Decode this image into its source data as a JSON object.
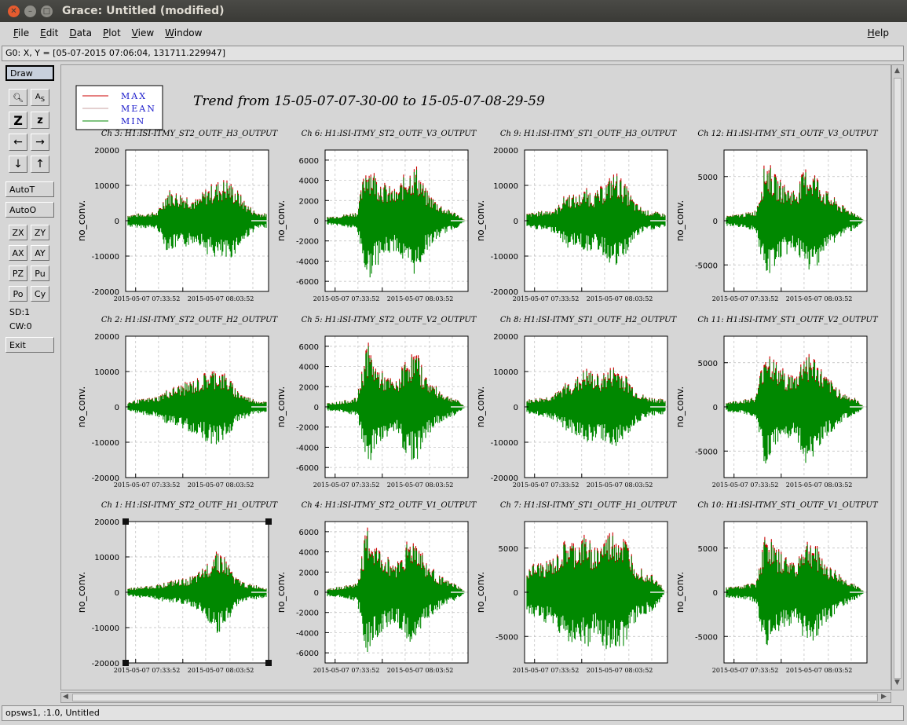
{
  "window": {
    "title": "Grace: Untitled (modified)"
  },
  "menu": {
    "items": [
      "File",
      "Edit",
      "Data",
      "Plot",
      "View",
      "Window"
    ],
    "help": "Help"
  },
  "locator": "G0: X, Y = [05-07-2015 07:06:04, 131711.229947]",
  "toolbar": {
    "draw": "Draw",
    "autot": "AutoT",
    "autoo": "AutoO",
    "zx": "ZX",
    "zy": "ZY",
    "ax": "AX",
    "ay": "AY",
    "pz": "PZ",
    "pu": "Pu",
    "po": "Po",
    "cy": "Cy",
    "sd": "SD:1",
    "cw": "CW:0",
    "exit": "Exit"
  },
  "status": "opsws1, :1.0, Untitled",
  "figure": {
    "title": "Trend from 15-05-07-07-30-00 to 15-05-07-08-29-59",
    "legend": [
      {
        "label": "MAX",
        "color": "#cc0000"
      },
      {
        "label": "MEAN",
        "color": "#c8a0a0"
      },
      {
        "label": "MIN",
        "color": "#008800"
      }
    ],
    "ylabel": "no_conv.",
    "xticks": [
      "2015-05-07 07:33:52",
      "2015-05-07 08:03:52"
    ]
  },
  "chart_data": [
    {
      "type": "line",
      "title": "Ch 3: H1:ISI-ITMY_ST2_OUTF_H3_OUTPUT",
      "ylabel": "no_conv.",
      "ylim": [
        -20000,
        20000
      ],
      "yticks": [
        20000,
        10000,
        0,
        -10000,
        -20000
      ],
      "xticks": [
        "2015-05-07 07:33:52",
        "2015-05-07 08:03:52"
      ],
      "series": [
        {
          "name": "MAX"
        },
        {
          "name": "MEAN"
        },
        {
          "name": "MIN"
        }
      ],
      "envelope": [
        1800,
        2000,
        2200,
        2500,
        9000,
        8000,
        7500,
        6000,
        9500,
        11000,
        12000,
        9000,
        5000,
        2500,
        2000
      ],
      "pos": [
        0,
        0
      ]
    },
    {
      "type": "line",
      "title": "Ch 6: H1:ISI-ITMY_ST2_OUTF_V3_OUTPUT",
      "ylabel": "no_conv.",
      "ylim": [
        -7000,
        7000
      ],
      "yticks": [
        6000,
        4000,
        2000,
        0,
        -2000,
        -4000,
        -6000
      ],
      "xticks": [
        "2015-05-07 07:33:52",
        "2015-05-07 08:03:52"
      ],
      "series": [
        {
          "name": "MAX"
        },
        {
          "name": "MEAN"
        },
        {
          "name": "MIN"
        }
      ],
      "envelope": [
        400,
        500,
        700,
        900,
        6200,
        4500,
        3500,
        3000,
        5000,
        5500,
        3000,
        2000,
        1200,
        800,
        0
      ],
      "pos": [
        0,
        1
      ]
    },
    {
      "type": "line",
      "title": "Ch 9: H1:ISI-ITMY_ST1_OUTF_H3_OUTPUT",
      "ylabel": "no_conv.",
      "ylim": [
        -20000,
        20000
      ],
      "yticks": [
        20000,
        10000,
        0,
        -10000,
        -20000
      ],
      "xticks": [
        "2015-05-07 07:33:52",
        "2015-05-07 08:03:52"
      ],
      "series": [
        {
          "name": "MAX"
        },
        {
          "name": "MEAN"
        },
        {
          "name": "MIN"
        }
      ],
      "envelope": [
        2000,
        2500,
        3000,
        3500,
        8000,
        7000,
        9000,
        8000,
        11000,
        14000,
        10000,
        5000,
        3000,
        2500,
        2000
      ],
      "pos": [
        0,
        2
      ]
    },
    {
      "type": "line",
      "title": "Ch 12: H1:ISI-ITMY_ST1_OUTF_V3_OUTPUT",
      "ylabel": "no_conv.",
      "ylim": [
        -8000,
        8000
      ],
      "yticks": [
        5000,
        0,
        -5000
      ],
      "xticks": [
        "2015-05-07 07:33:52",
        "2015-05-07 08:03:52"
      ],
      "series": [
        {
          "name": "MAX"
        },
        {
          "name": "MEAN"
        },
        {
          "name": "MIN"
        }
      ],
      "envelope": [
        600,
        700,
        900,
        1200,
        7200,
        5000,
        4000,
        3500,
        6000,
        5500,
        3500,
        2500,
        1500,
        1000,
        0
      ],
      "pos": [
        0,
        3
      ]
    },
    {
      "type": "line",
      "title": "Ch 2: H1:ISI-ITMY_ST2_OUTF_H2_OUTPUT",
      "ylabel": "no_conv.",
      "ylim": [
        -20000,
        20000
      ],
      "yticks": [
        20000,
        10000,
        0,
        -10000,
        -20000
      ],
      "xticks": [
        "2015-05-07 07:33:52",
        "2015-05-07 08:03:52"
      ],
      "series": [
        {
          "name": "MAX"
        },
        {
          "name": "MEAN"
        },
        {
          "name": "MIN"
        }
      ],
      "envelope": [
        1500,
        2000,
        2500,
        3000,
        5000,
        6000,
        7000,
        8000,
        10000,
        11000,
        9000,
        5000,
        3000,
        2000,
        1500
      ],
      "pos": [
        1,
        0
      ]
    },
    {
      "type": "line",
      "title": "Ch 5: H1:ISI-ITMY_ST2_OUTF_V2_OUTPUT",
      "ylabel": "no_conv.",
      "ylim": [
        -7000,
        7000
      ],
      "yticks": [
        6000,
        4000,
        2000,
        0,
        -2000,
        -4000,
        -6000
      ],
      "xticks": [
        "2015-05-07 07:33:52",
        "2015-05-07 08:03:52"
      ],
      "series": [
        {
          "name": "MAX"
        },
        {
          "name": "MEAN"
        },
        {
          "name": "MIN"
        }
      ],
      "envelope": [
        400,
        500,
        700,
        900,
        6500,
        4000,
        3000,
        2500,
        5000,
        5500,
        3000,
        2000,
        1200,
        800,
        0
      ],
      "pos": [
        1,
        1
      ]
    },
    {
      "type": "line",
      "title": "Ch 8: H1:ISI-ITMY_ST1_OUTF_H2_OUTPUT",
      "ylabel": "no_conv.",
      "ylim": [
        -20000,
        20000
      ],
      "yticks": [
        20000,
        10000,
        0,
        -10000,
        -20000
      ],
      "xticks": [
        "2015-05-07 07:33:52",
        "2015-05-07 08:03:52"
      ],
      "series": [
        {
          "name": "MAX"
        },
        {
          "name": "MEAN"
        },
        {
          "name": "MIN"
        }
      ],
      "envelope": [
        2000,
        2500,
        3000,
        4000,
        7000,
        8000,
        11000,
        9000,
        10000,
        12000,
        9000,
        5000,
        3000,
        2500,
        2000
      ],
      "pos": [
        1,
        2
      ]
    },
    {
      "type": "line",
      "title": "Ch 11: H1:ISI-ITMY_ST1_OUTF_V2_OUTPUT",
      "ylabel": "no_conv.",
      "ylim": [
        -8000,
        8000
      ],
      "yticks": [
        5000,
        0,
        -5000
      ],
      "xticks": [
        "2015-05-07 07:33:52",
        "2015-05-07 08:03:52"
      ],
      "series": [
        {
          "name": "MAX"
        },
        {
          "name": "MEAN"
        },
        {
          "name": "MIN"
        }
      ],
      "envelope": [
        600,
        700,
        900,
        1200,
        7300,
        5000,
        4000,
        3500,
        6500,
        5500,
        3500,
        2500,
        1500,
        1000,
        0
      ],
      "pos": [
        1,
        3
      ]
    },
    {
      "type": "line",
      "title": "Ch 1: H1:ISI-ITMY_ST2_OUTF_H1_OUTPUT",
      "ylabel": "no_conv.",
      "ylim": [
        -20000,
        20000
      ],
      "yticks": [
        20000,
        10000,
        0,
        -10000,
        -20000
      ],
      "xticks": [
        "2015-05-07 07:33:52",
        "2015-05-07 08:03:52"
      ],
      "series": [
        {
          "name": "MAX"
        },
        {
          "name": "MEAN"
        },
        {
          "name": "MIN"
        }
      ],
      "envelope": [
        1200,
        1500,
        1800,
        2200,
        3000,
        3500,
        4000,
        5000,
        8000,
        13000,
        9000,
        4000,
        2500,
        2000,
        1500
      ],
      "pos": [
        2,
        0
      ],
      "selected": true
    },
    {
      "type": "line",
      "title": "Ch 4: H1:ISI-ITMY_ST2_OUTF_V1_OUTPUT",
      "ylabel": "no_conv.",
      "ylim": [
        -7000,
        7000
      ],
      "yticks": [
        6000,
        4000,
        2000,
        0,
        -2000,
        -4000,
        -6000
      ],
      "xticks": [
        "2015-05-07 07:33:52",
        "2015-05-07 08:03:52"
      ],
      "series": [
        {
          "name": "MAX"
        },
        {
          "name": "MEAN"
        },
        {
          "name": "MIN"
        }
      ],
      "envelope": [
        400,
        500,
        700,
        900,
        6500,
        4500,
        3500,
        3000,
        5000,
        5500,
        3000,
        2000,
        1200,
        800,
        0
      ],
      "pos": [
        2,
        1
      ]
    },
    {
      "type": "line",
      "title": "Ch 7: H1:ISI-ITMY_ST1_OUTF_H1_OUTPUT",
      "ylabel": "no_conv.",
      "ylim": [
        -8000,
        8000
      ],
      "yticks": [
        5000,
        0,
        -5000
      ],
      "xticks": [
        "2015-05-07 07:33:52",
        "2015-05-07 08:03:52"
      ],
      "series": [
        {
          "name": "MAX"
        },
        {
          "name": "MEAN"
        },
        {
          "name": "MIN"
        }
      ],
      "envelope": [
        3000,
        3200,
        3500,
        4000,
        6000,
        5500,
        6500,
        5000,
        6500,
        7000,
        6000,
        3500,
        2500,
        2000,
        0
      ],
      "pos": [
        2,
        2
      ]
    },
    {
      "type": "line",
      "title": "Ch 10: H1:ISI-ITMY_ST1_OUTF_V1_OUTPUT",
      "ylabel": "no_conv.",
      "ylim": [
        -8000,
        8000
      ],
      "yticks": [
        5000,
        0,
        -5000
      ],
      "xticks": [
        "2015-05-07 07:33:52",
        "2015-05-07 08:03:52"
      ],
      "series": [
        {
          "name": "MAX"
        },
        {
          "name": "MEAN"
        },
        {
          "name": "MIN"
        }
      ],
      "envelope": [
        600,
        700,
        900,
        1200,
        7000,
        5000,
        4000,
        3500,
        6000,
        5500,
        3500,
        2500,
        1500,
        1000,
        0
      ],
      "pos": [
        2,
        3
      ]
    }
  ]
}
